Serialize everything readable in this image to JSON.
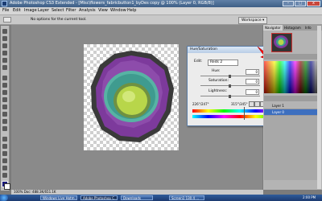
{
  "window": {
    "title": "Adobe Photoshop CS3 Extended - [Misc\\flowers_fabricbutton1_byDes copy @ 100% (Layer 0, RGB/8)]"
  },
  "menu": [
    "File",
    "Edit",
    "Image",
    "Layer",
    "Select",
    "Filter",
    "Analysis",
    "View",
    "Window",
    "Help"
  ],
  "options_bar": {
    "message": "No options for the current tool.",
    "workspace": "Workspace ▾"
  },
  "canvas": {
    "zoom": "100%",
    "subject": "layered fabric button"
  },
  "dialog": {
    "title": "Hue/Saturation",
    "edit_label": "Edit:",
    "edit_value": "Reds 2",
    "hue_label": "Hue:",
    "hue_value": "0",
    "saturation_label": "Saturation:",
    "saturation_value": "0",
    "lightness_label": "Lightness:",
    "lightness_value": "0",
    "range_left": "226°/247°",
    "range_right": "315°\\345°",
    "buttons": {
      "ok": "OK",
      "cancel": "Cancel",
      "load": "Load...",
      "save": "Save..."
    },
    "colorize_label": "Colorize",
    "preview_label": "Preview",
    "preview_checked": true
  },
  "panels": {
    "tabs": [
      "Navigator",
      "Histogram",
      "Info"
    ],
    "layers": [
      "Layer 1",
      "Layer 0"
    ]
  },
  "status": {
    "text": "100%    Doc: 488.3K/651.1K"
  },
  "taskbar": {
    "items": [
      "Windows Live Hotm...",
      "Adobe Photoshop C...",
      "Downloads",
      "Screen1 130.4 ..."
    ],
    "clock": "2:00 PM"
  },
  "colors": {
    "accent_red": "#ff0000",
    "selected_layer": "#3d6fbf",
    "purple_ring": "#7d3a9c",
    "teal_ring": "#3f9b8f",
    "lime_center": "#b8d64a"
  }
}
